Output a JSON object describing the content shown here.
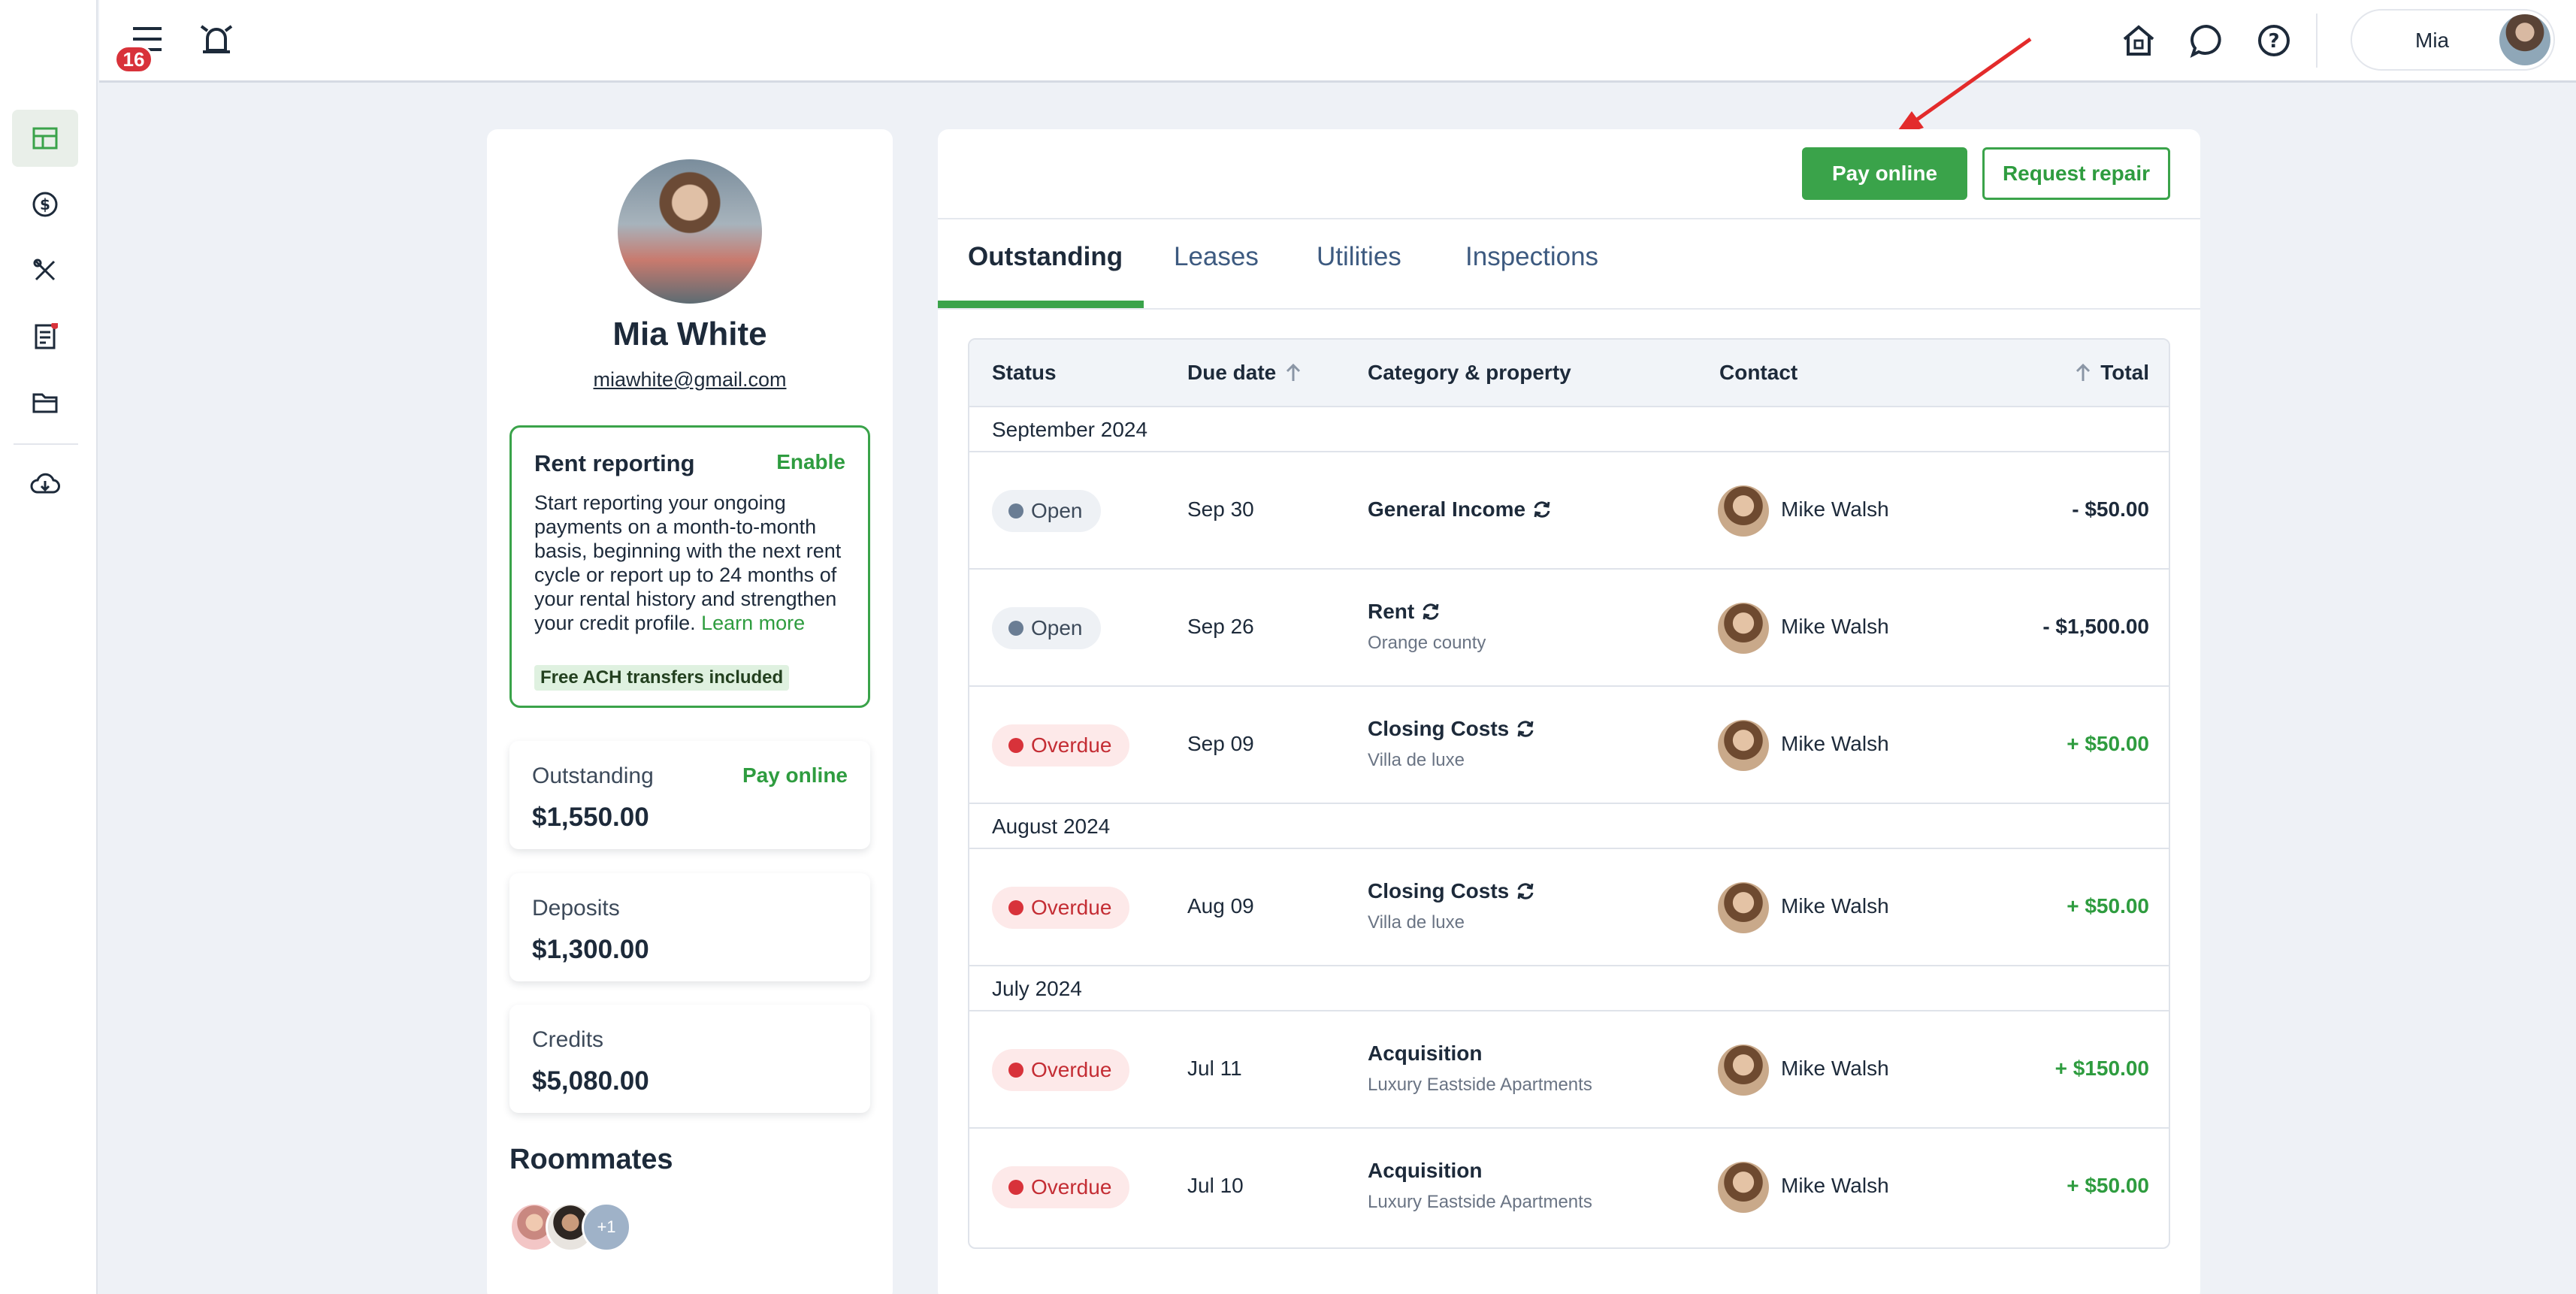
{
  "topbar": {
    "notifications_count": "16",
    "user_name": "Mia"
  },
  "profile": {
    "name": "Mia White",
    "email": "miawhite@gmail.com"
  },
  "rent_reporting": {
    "title": "Rent reporting",
    "enable_label": "Enable",
    "description": "Start reporting your ongoing payments on a month-to-month basis, beginning with the next rent cycle or report up to 24 months of your rental history and strengthen your credit profile.",
    "learn_more": "Learn more",
    "free_badge": "Free ACH transfers included"
  },
  "stats": {
    "outstanding": {
      "label": "Outstanding",
      "value": "$1,550.00",
      "link": "Pay online"
    },
    "deposits": {
      "label": "Deposits",
      "value": "$1,300.00"
    },
    "credits": {
      "label": "Credits",
      "value": "$5,080.00"
    }
  },
  "roommates": {
    "title": "Roommates",
    "more": "+1"
  },
  "actions": {
    "pay_online": "Pay online",
    "request_repair": "Request repair"
  },
  "tabs": [
    "Outstanding",
    "Leases",
    "Utilities",
    "Inspections"
  ],
  "table": {
    "headers": {
      "status": "Status",
      "due_date": "Due date",
      "category": "Category & property",
      "contact": "Contact",
      "total": "Total"
    },
    "groups": [
      "September 2024",
      "August 2024",
      "July 2024"
    ],
    "rows": [
      {
        "status": "Open",
        "due": "Sep 30",
        "category": "General Income",
        "property": "",
        "contact": "Mike Walsh",
        "total": "- $50.00"
      },
      {
        "status": "Open",
        "due": "Sep 26",
        "category": "Rent",
        "property": "Orange county",
        "contact": "Mike Walsh",
        "total": "- $1,500.00"
      },
      {
        "status": "Overdue",
        "due": "Sep 09",
        "category": "Closing Costs",
        "property": "Villa de luxe",
        "contact": "Mike Walsh",
        "total": "+ $50.00"
      },
      {
        "status": "Overdue",
        "due": "Aug 09",
        "category": "Closing Costs",
        "property": "Villa de luxe",
        "contact": "Mike Walsh",
        "total": "+ $50.00"
      },
      {
        "status": "Overdue",
        "due": "Jul 11",
        "category": "Acquisition",
        "property": "Luxury Eastside Apartments",
        "contact": "Mike Walsh",
        "total": "+ $150.00"
      },
      {
        "status": "Overdue",
        "due": "Jul 10",
        "category": "Acquisition",
        "property": "Luxury Eastside Apartments",
        "contact": "Mike Walsh",
        "total": "+ $50.00"
      }
    ]
  },
  "colors": {
    "accent": "#3aa34a",
    "danger": "#d8323a",
    "text": "#1d2a3a"
  }
}
